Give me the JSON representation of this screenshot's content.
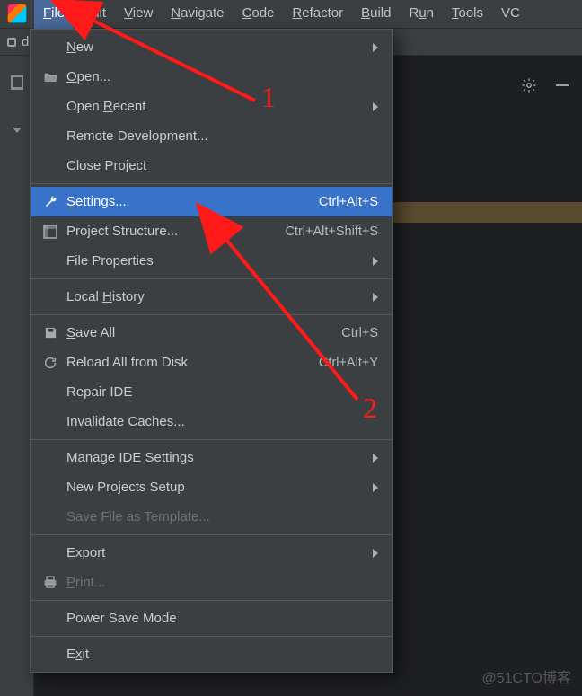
{
  "menubar": {
    "items": [
      {
        "label": "File",
        "mn": "F",
        "active": true
      },
      {
        "label": "Edit",
        "mn": "E"
      },
      {
        "label": "View",
        "mn": "V"
      },
      {
        "label": "Navigate",
        "mn": "N"
      },
      {
        "label": "Code",
        "mn": "C"
      },
      {
        "label": "Refactor",
        "mn": "R"
      },
      {
        "label": "Build",
        "mn": "B"
      },
      {
        "label": "Run",
        "mn": "u"
      },
      {
        "label": "Tools",
        "mn": "T"
      },
      {
        "label": "VC",
        "mn": ""
      }
    ]
  },
  "tab": {
    "label": "de"
  },
  "dropdown": {
    "items": [
      {
        "icon": "",
        "label": "New",
        "mn": "N",
        "shortcut": "",
        "submenu": true
      },
      {
        "icon": "folder-open",
        "label": "Open...",
        "mn": "O",
        "shortcut": ""
      },
      {
        "icon": "",
        "label": "Open Recent",
        "mn": "R",
        "shortcut": "",
        "submenu": true
      },
      {
        "icon": "",
        "label": "Remote Development...",
        "mn": ""
      },
      {
        "icon": "",
        "label": "Close Project",
        "mn": "J"
      },
      {
        "sep": true
      },
      {
        "icon": "wrench",
        "label": "Settings...",
        "mn": "S",
        "shortcut": "Ctrl+Alt+S",
        "highlight": true
      },
      {
        "icon": "project-structure",
        "label": "Project Structure...",
        "mn": "",
        "shortcut": "Ctrl+Alt+Shift+S"
      },
      {
        "icon": "",
        "label": "File Properties",
        "mn": "",
        "submenu": true
      },
      {
        "sep": true
      },
      {
        "icon": "",
        "label": "Local History",
        "mn": "H",
        "submenu": true
      },
      {
        "sep": true
      },
      {
        "icon": "save",
        "label": "Save All",
        "mn": "S",
        "shortcut": "Ctrl+S"
      },
      {
        "icon": "reload",
        "label": "Reload All from Disk",
        "mn": "",
        "shortcut": "Ctrl+Alt+Y"
      },
      {
        "icon": "",
        "label": "Repair IDE",
        "mn": ""
      },
      {
        "icon": "",
        "label": "Invalidate Caches...",
        "mn": "a"
      },
      {
        "sep": true
      },
      {
        "icon": "",
        "label": "Manage IDE Settings",
        "mn": "",
        "submenu": true
      },
      {
        "icon": "",
        "label": "New Projects Setup",
        "mn": "",
        "submenu": true
      },
      {
        "icon": "",
        "label": "Save File as Template...",
        "mn": "",
        "disabled": true
      },
      {
        "sep": true
      },
      {
        "icon": "",
        "label": "Export",
        "mn": "",
        "submenu": true
      },
      {
        "icon": "print",
        "label": "Print...",
        "mn": "P",
        "disabled": true
      },
      {
        "sep": true
      },
      {
        "icon": "",
        "label": "Power Save Mode",
        "mn": ""
      },
      {
        "sep": true
      },
      {
        "icon": "",
        "label": "Exit",
        "mn": "x"
      }
    ]
  },
  "annotations": {
    "one": "1",
    "two": "2"
  },
  "watermark": "@51CTO博客"
}
